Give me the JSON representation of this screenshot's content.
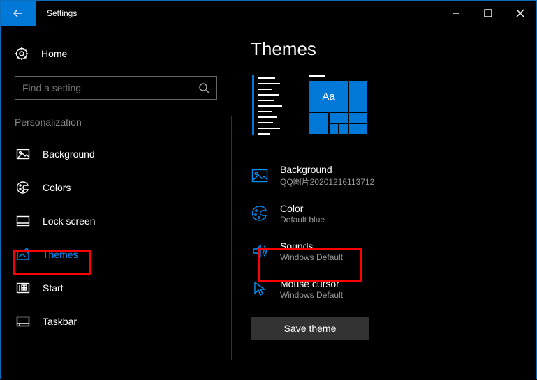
{
  "window": {
    "title": "Settings"
  },
  "sidebar": {
    "home": "Home",
    "search_placeholder": "Find a setting",
    "section": "Personalization",
    "items": [
      {
        "label": "Background"
      },
      {
        "label": "Colors"
      },
      {
        "label": "Lock screen"
      },
      {
        "label": "Themes"
      },
      {
        "label": "Start"
      },
      {
        "label": "Taskbar"
      }
    ]
  },
  "main": {
    "title": "Themes",
    "preview_tile_label": "Aa",
    "settings": {
      "background": {
        "title": "Background",
        "sub": "QQ图片20201216113712"
      },
      "color": {
        "title": "Color",
        "sub": "Default blue"
      },
      "sounds": {
        "title": "Sounds",
        "sub": "Windows Default"
      },
      "mouse": {
        "title": "Mouse cursor",
        "sub": "Windows Default"
      }
    },
    "save_btn": "Save theme"
  }
}
